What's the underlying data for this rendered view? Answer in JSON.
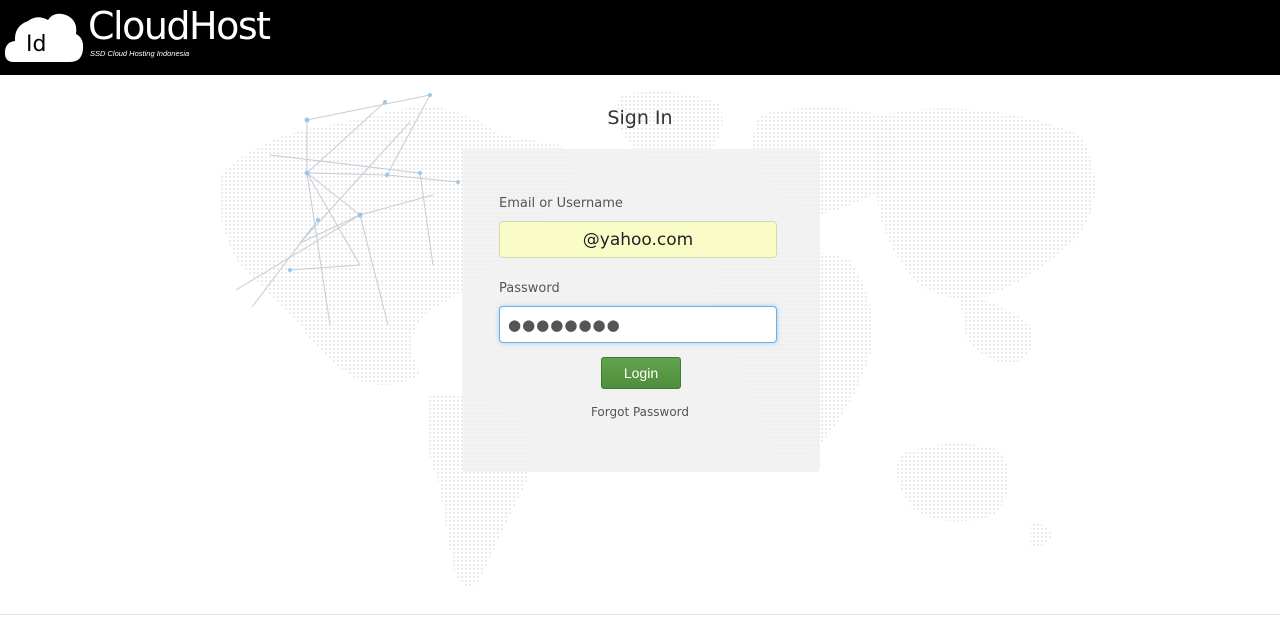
{
  "brand": {
    "logo_badge": "Id",
    "name": "CloudHost",
    "tagline": "SSD Cloud Hosting Indonesia"
  },
  "login": {
    "title": "Sign In",
    "email_label": "Email or Username",
    "email_value": "@yahoo.com",
    "password_label": "Password",
    "password_value": "●●●●●●●●",
    "login_button": "Login",
    "forgot_password": "Forgot Password"
  },
  "icons": {
    "logo": "cloud-logo-icon",
    "background": "world-map-network-graphic"
  },
  "colors": {
    "header_bg": "#000000",
    "email_field_bg": "#fafcc8",
    "password_focus_border": "#66afe9",
    "login_button_bg": "#5a9c46"
  }
}
